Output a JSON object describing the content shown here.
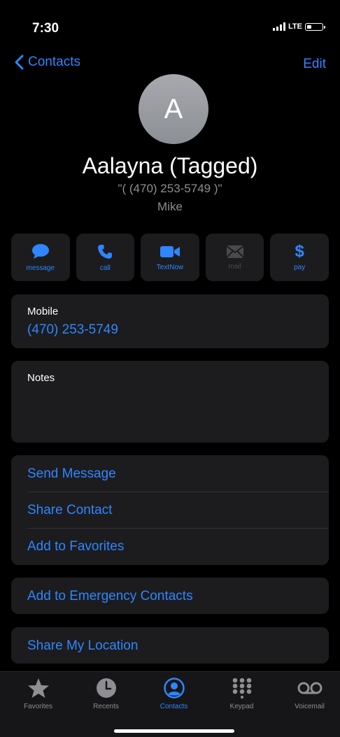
{
  "status": {
    "time": "7:30",
    "network": "LTE"
  },
  "nav": {
    "back_label": "Contacts",
    "edit_label": "Edit"
  },
  "contact": {
    "initial": "A",
    "name": "Aalayna (Tagged)",
    "nickname": "\"( (470) 253-5749 )\"",
    "company": "Mike"
  },
  "actions": [
    {
      "label": "message",
      "icon": "message-bubble-icon"
    },
    {
      "label": "call",
      "icon": "phone-icon"
    },
    {
      "label": "TextNow",
      "icon": "video-icon"
    },
    {
      "label": "mail",
      "icon": "mail-icon",
      "disabled": true
    },
    {
      "label": "pay",
      "icon": "dollar-icon"
    }
  ],
  "mobile": {
    "label": "Mobile",
    "number": "(470) 253-5749"
  },
  "notes": {
    "label": "Notes"
  },
  "options": [
    {
      "label": "Send Message"
    },
    {
      "label": "Share Contact"
    },
    {
      "label": "Add to Favorites"
    }
  ],
  "emergency": {
    "label": "Add to Emergency Contacts"
  },
  "location": {
    "label": "Share My Location"
  },
  "tabs": [
    {
      "label": "Favorites",
      "icon": "star-icon"
    },
    {
      "label": "Recents",
      "icon": "clock-icon"
    },
    {
      "label": "Contacts",
      "icon": "person-circle-icon",
      "active": true
    },
    {
      "label": "Keypad",
      "icon": "keypad-icon"
    },
    {
      "label": "Voicemail",
      "icon": "voicemail-icon"
    }
  ],
  "colors": {
    "accent": "#2f86ff",
    "background": "#000000",
    "card": "#1c1c1e",
    "secondary_text": "#8e8e93"
  }
}
